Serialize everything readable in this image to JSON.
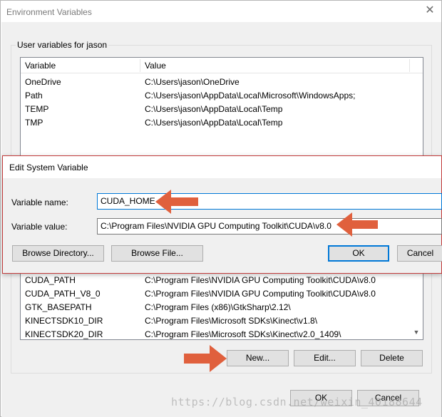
{
  "window": {
    "title": "Environment Variables"
  },
  "user_vars": {
    "legend": "User variables for jason",
    "headers": {
      "variable": "Variable",
      "value": "Value"
    },
    "rows": [
      {
        "name": "OneDrive",
        "value": "C:\\Users\\jason\\OneDrive"
      },
      {
        "name": "Path",
        "value": "C:\\Users\\jason\\AppData\\Local\\Microsoft\\WindowsApps;"
      },
      {
        "name": "TEMP",
        "value": "C:\\Users\\jason\\AppData\\Local\\Temp"
      },
      {
        "name": "TMP",
        "value": "C:\\Users\\jason\\AppData\\Local\\Temp"
      }
    ]
  },
  "system_vars": {
    "rows": [
      {
        "name": "CUDA_PATH",
        "value": "C:\\Program Files\\NVIDIA GPU Computing Toolkit\\CUDA\\v8.0"
      },
      {
        "name": "CUDA_PATH_V8_0",
        "value": "C:\\Program Files\\NVIDIA GPU Computing Toolkit\\CUDA\\v8.0"
      },
      {
        "name": "GTK_BASEPATH",
        "value": "C:\\Program Files (x86)\\GtkSharp\\2.12\\"
      },
      {
        "name": "KINECTSDK10_DIR",
        "value": "C:\\Program Files\\Microsoft SDKs\\Kinect\\v1.8\\"
      },
      {
        "name": "KINECTSDK20_DIR",
        "value": "C:\\Program Files\\Microsoft SDKs\\Kinect\\v2.0_1409\\"
      }
    ],
    "buttons": {
      "new": "New...",
      "edit": "Edit...",
      "delete": "Delete"
    }
  },
  "footer": {
    "ok": "OK",
    "cancel": "Cancel"
  },
  "edit_dialog": {
    "title": "Edit System Variable",
    "name_label": "Variable name:",
    "name_value": "CUDA_HOME",
    "value_label": "Variable value:",
    "value_value": "C:\\Program Files\\NVIDIA GPU Computing Toolkit\\CUDA\\v8.0",
    "browse_directory": "Browse Directory...",
    "browse_file": "Browse File...",
    "ok": "OK",
    "cancel": "Cancel"
  },
  "watermark": "https://blog.csdn.net/weixin_40188644",
  "colors": {
    "annotation_arrow": "#e0603d",
    "accent": "#0078d7",
    "dialog_border": "#c23b3b"
  },
  "icons": {
    "close": "close-icon",
    "scroll_down": "chevron-down-icon",
    "arrow": "arrow-left-icon"
  }
}
